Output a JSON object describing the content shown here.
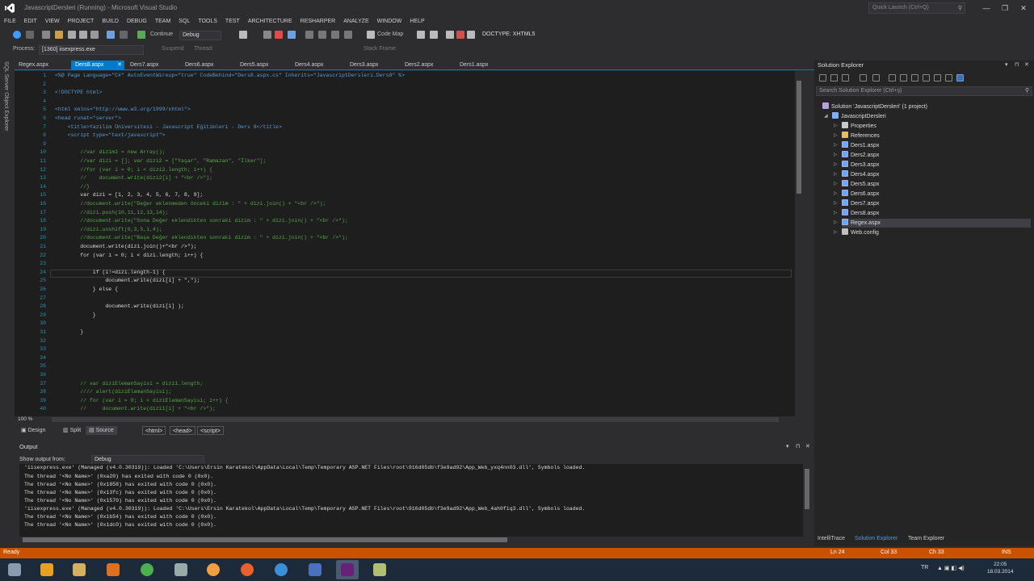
{
  "window": {
    "title": "JavascriptDersleri (Running) - Microsoft Visual Studio",
    "quick_launch_placeholder": "Quick Launch (Ctrl+Q)"
  },
  "menu": [
    "FILE",
    "EDIT",
    "VIEW",
    "PROJECT",
    "BUILD",
    "DEBUG",
    "TEAM",
    "SQL",
    "TOOLS",
    "TEST",
    "ARCHITECTURE",
    "RESHARPER",
    "ANALYZE",
    "WINDOW",
    "HELP"
  ],
  "toolbar": {
    "continue_label": "Continue",
    "debug_target": "Debug",
    "code_map_label": "Code Map",
    "doctype_value": "DOCTYPE: XHTML5",
    "suspend_label": "Suspend",
    "thread_label": "Thread:",
    "stack_frame_label": "Stack Frame:"
  },
  "process": {
    "label": "Process:",
    "value": "[1360] iisexpress.exe"
  },
  "tabs": [
    {
      "label": "Regex.aspx",
      "active": false
    },
    {
      "label": "Ders8.aspx",
      "active": true
    },
    {
      "label": "Ders7.aspx",
      "active": false
    },
    {
      "label": "Ders6.aspx",
      "active": false
    },
    {
      "label": "Ders5.aspx",
      "active": false
    },
    {
      "label": "Ders4.aspx",
      "active": false
    },
    {
      "label": "Ders3.aspx",
      "active": false
    },
    {
      "label": "Ders2.aspx",
      "active": false
    },
    {
      "label": "Ders1.aspx",
      "active": false
    }
  ],
  "left_tool_label": "SQL Server Object Explorer",
  "editor": {
    "zoom": "100 %",
    "lines": [
      {
        "n": "1",
        "t": "<%@ Page Language=\"C#\" AutoEventWireup=\"true\" CodeBehind=\"Ders8.aspx.cs\" Inherits=\"JavascriptDersleri.Ders8\" %>",
        "c": "tag"
      },
      {
        "n": "2",
        "t": "",
        "c": ""
      },
      {
        "n": "3",
        "t": "<!DOCTYPE html>",
        "c": "tag"
      },
      {
        "n": "4",
        "t": "",
        "c": ""
      },
      {
        "n": "5",
        "t": "<html xmlns=\"http://www.w3.org/1999/xhtml\">",
        "c": "tag"
      },
      {
        "n": "6",
        "t": "<head runat=\"server\">",
        "c": "tag"
      },
      {
        "n": "7",
        "t": "    <title>Yazilim Üniversitesi - Javascript Eğitimleri - Ders 8</title>",
        "c": "tag"
      },
      {
        "n": "8",
        "t": "    <script type=\"text/javascript\">",
        "c": "tag"
      },
      {
        "n": "9",
        "t": "",
        "c": ""
      },
      {
        "n": "10",
        "t": "        //var dizim1 = new Array();",
        "c": "cm"
      },
      {
        "n": "11",
        "t": "        //var dizi = []; var dizi2 = [\"Yaşar\", \"Ramazan\", \"İlker\"];",
        "c": "cm"
      },
      {
        "n": "12",
        "t": "        //for (var i = 0; i < dizi2.length; i++) {",
        "c": "cm"
      },
      {
        "n": "13",
        "t": "        //    document.write(dizi2[i] + \"<br />\");",
        "c": "cm"
      },
      {
        "n": "14",
        "t": "        //}",
        "c": "cm"
      },
      {
        "n": "15",
        "t": "        var dizi = [1, 2, 3, 4, 5, 6, 7, 8, 9];",
        "c": "code"
      },
      {
        "n": "16",
        "t": "        //document.write(\"Değer eklenmeden önceki dizim : \" + dizi.join() + \"<br />\");",
        "c": "cm"
      },
      {
        "n": "17",
        "t": "        //dizi.push(10,11,12,13,14);",
        "c": "cm"
      },
      {
        "n": "18",
        "t": "        //document.write(\"Sona Değer eklendikten sonraki dizim : \" + dizi.join() + \"<br />\");",
        "c": "cm"
      },
      {
        "n": "19",
        "t": "        //dizi.unshift(0,3,5,1,4);",
        "c": "cm"
      },
      {
        "n": "20",
        "t": "        //document.write(\"Başa Değer eklendikten sonraki dizim : \" + dizi.join() + \"<br />\");",
        "c": "cm"
      },
      {
        "n": "21",
        "t": "        document.write(dizi.join()+\"<br />\");",
        "c": "code"
      },
      {
        "n": "22",
        "t": "        for (var i = 0; i < dizi.length; i++) {",
        "c": "code"
      },
      {
        "n": "23",
        "t": "",
        "c": ""
      },
      {
        "n": "24",
        "t": "            if (i!=dizi.length-1) {",
        "c": "code"
      },
      {
        "n": "25",
        "t": "                document.write(dizi[i] + \",\");",
        "c": "code"
      },
      {
        "n": "26",
        "t": "            } else {",
        "c": "code"
      },
      {
        "n": "27",
        "t": "",
        "c": ""
      },
      {
        "n": "28",
        "t": "                document.write(dizi[i] );",
        "c": "code"
      },
      {
        "n": "29",
        "t": "            }",
        "c": "code"
      },
      {
        "n": "30",
        "t": "",
        "c": ""
      },
      {
        "n": "31",
        "t": "        }",
        "c": "code"
      },
      {
        "n": "32",
        "t": "",
        "c": ""
      },
      {
        "n": "33",
        "t": "",
        "c": ""
      },
      {
        "n": "34",
        "t": "",
        "c": ""
      },
      {
        "n": "35",
        "t": "",
        "c": ""
      },
      {
        "n": "36",
        "t": "",
        "c": ""
      },
      {
        "n": "37",
        "t": "        // var diziElemanSayisi = dizi1.length;",
        "c": "cm"
      },
      {
        "n": "38",
        "t": "        //// alert(diziElemanSayisi);",
        "c": "cm"
      },
      {
        "n": "39",
        "t": "        // for (var i = 0; i < diziElemanSayisi; i++) {",
        "c": "cm"
      },
      {
        "n": "40",
        "t": "        //     document.write(dizi1[i] + \"<br />\");",
        "c": "cm"
      }
    ]
  },
  "design_bar": {
    "design": "Design",
    "split": "Split",
    "source": "Source",
    "crumbs": [
      "<html>",
      "<head>",
      "<script>"
    ]
  },
  "output": {
    "title": "Output",
    "show_from_label": "Show output from:",
    "show_from_value": "Debug",
    "lines": [
      "'iisexpress.exe' (Managed (v4.0.30319)): Loaded 'C:\\Users\\Ersin Karatekol\\AppData\\Local\\Temp\\Temporary ASP.NET Files\\root\\916d05db\\f3e9ad92\\App_Web_yxq4nn03.dll', Symbols loaded.",
      "The thread '<No Name>' (0xa20) has exited with code 0 (0x0).",
      "The thread '<No Name>' (0x1858) has exited with code 0 (0x0).",
      "The thread '<No Name>' (0x13fc) has exited with code 0 (0x0).",
      "The thread '<No Name>' (0x1570) has exited with code 0 (0x0).",
      "'iisexpress.exe' (Managed (v4.0.30319)): Loaded 'C:\\Users\\Ersin Karatekol\\AppData\\Local\\Temp\\Temporary ASP.NET Files\\root\\916d05db\\f3e9ad92\\App_Web_4ah0fiq3.dll', Symbols loaded.",
      "The thread '<No Name>' (0x1b54) has exited with code 0 (0x0).",
      "The thread '<No Name>' (0x1dc0) has exited with code 0 (0x0)."
    ]
  },
  "solution_explorer": {
    "title": "Solution Explorer",
    "search_placeholder": "Search Solution Explorer (Ctrl+ş)",
    "items": [
      {
        "label": "Solution 'JavascriptDersleri' (1 project)",
        "icon": "sol",
        "depth": 0,
        "arrow": "",
        "sel": false
      },
      {
        "label": "JavascriptDersleri",
        "icon": "proj",
        "depth": 1,
        "arrow": "◢",
        "sel": false
      },
      {
        "label": "Properties",
        "icon": "props",
        "depth": 2,
        "arrow": "▷",
        "sel": false
      },
      {
        "label": "References",
        "icon": "refs",
        "depth": 2,
        "arrow": "▷",
        "sel": false
      },
      {
        "label": "Ders1.aspx",
        "icon": "page",
        "depth": 2,
        "arrow": "▷",
        "sel": false
      },
      {
        "label": "Ders2.aspx",
        "icon": "page",
        "depth": 2,
        "arrow": "▷",
        "sel": false
      },
      {
        "label": "Ders3.aspx",
        "icon": "page",
        "depth": 2,
        "arrow": "▷",
        "sel": false
      },
      {
        "label": "Ders4.aspx",
        "icon": "page",
        "depth": 2,
        "arrow": "▷",
        "sel": false
      },
      {
        "label": "Ders5.aspx",
        "icon": "page",
        "depth": 2,
        "arrow": "▷",
        "sel": false
      },
      {
        "label": "Ders6.aspx",
        "icon": "page",
        "depth": 2,
        "arrow": "▷",
        "sel": false
      },
      {
        "label": "Ders7.aspx",
        "icon": "page",
        "depth": 2,
        "arrow": "▷",
        "sel": false
      },
      {
        "label": "Ders8.aspx",
        "icon": "page",
        "depth": 2,
        "arrow": "▷",
        "sel": false
      },
      {
        "label": "Regex.aspx",
        "icon": "page",
        "depth": 2,
        "arrow": "▷",
        "sel": true
      },
      {
        "label": "Web.config",
        "icon": "cfg",
        "depth": 2,
        "arrow": "▷",
        "sel": false
      }
    ],
    "bottom_tabs": [
      "IntelliTrace",
      "Solution Explorer",
      "Team Explorer"
    ]
  },
  "status": {
    "ready": "Ready",
    "ln": "Ln 24",
    "col": "Col 33",
    "ch": "Ch 33",
    "ins": "INS"
  },
  "taskbar": {
    "lang": "TR",
    "time": "22:05",
    "date": "18.03.2014"
  }
}
